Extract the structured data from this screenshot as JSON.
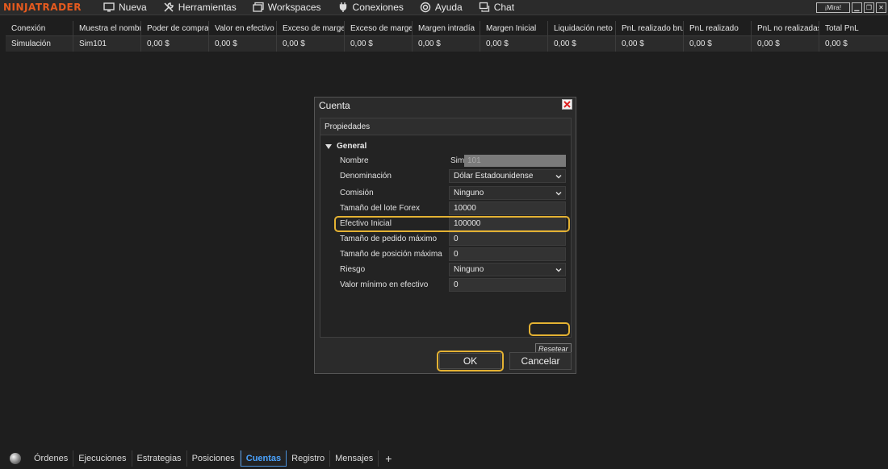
{
  "app": {
    "logo": "NINJATRADER"
  },
  "menu": [
    {
      "label": "Nueva",
      "icon": "monitor-icon"
    },
    {
      "label": "Herramientas",
      "icon": "tools-icon"
    },
    {
      "label": "Workspaces",
      "icon": "windows-icon"
    },
    {
      "label": "Conexiones",
      "icon": "plug-icon"
    },
    {
      "label": "Ayuda",
      "icon": "lifebuoy-icon"
    },
    {
      "label": "Chat",
      "icon": "chat-icon"
    }
  ],
  "window_buttons": {
    "mira": "¡Mira!",
    "minimize": "▁",
    "restore": "❐",
    "close": "✕"
  },
  "table": {
    "columns": [
      "Conexión",
      "Muestra el nombre",
      "Poder de compra",
      "Valor en efectivo",
      "Exceso de margen",
      "Exceso de margen",
      "Margen intradía",
      "Margen Inicial",
      "Liquidación neto",
      "PnL realizado bruto",
      "PnL realizado",
      "PnL no realizadas",
      "Total PnL"
    ],
    "rows": [
      [
        "Simulación",
        "Sim101",
        "0,00 $",
        "0,00 $",
        "0,00 $",
        "0,00 $",
        "0,00 $",
        "0,00 $",
        "0,00 $",
        "0,00 $",
        "0,00 $",
        "0,00 $",
        "0,00 $"
      ]
    ]
  },
  "dialog": {
    "title": "Cuenta",
    "properties_header": "Propiedades",
    "section": "General",
    "name_label": "Nombre",
    "name_prefix": "Sim",
    "name_value": "101",
    "rows": [
      {
        "label": "Denominación",
        "value": "Dólar Estadounidense",
        "dropdown": true
      },
      {
        "label": "Comisión",
        "value": "Ninguno",
        "dropdown": true
      },
      {
        "label": "Tamaño del lote Forex",
        "value": "10000",
        "dropdown": false
      },
      {
        "label": "Efectivo Inicial",
        "value": "100000",
        "dropdown": false
      },
      {
        "label": "Tamaño de pedido máximo",
        "value": "0",
        "dropdown": false
      },
      {
        "label": "Tamaño de posición máxima",
        "value": "0",
        "dropdown": false
      },
      {
        "label": "Riesgo",
        "value": "Ninguno",
        "dropdown": true
      },
      {
        "label": "Valor mínimo en efectivo",
        "value": "0",
        "dropdown": false
      }
    ],
    "reset_label": "Resetear",
    "ok_label": "OK",
    "cancel_label": "Cancelar"
  },
  "tabs": {
    "items": [
      "Órdenes",
      "Ejecuciones",
      "Estrategias",
      "Posiciones",
      "Cuentas",
      "Registro",
      "Mensajes"
    ],
    "active": "Cuentas",
    "add_label": "+"
  },
  "colors": {
    "highlight": "#e4b233",
    "logo": "#e65a1e",
    "active_tab": "#4aa3ff"
  }
}
